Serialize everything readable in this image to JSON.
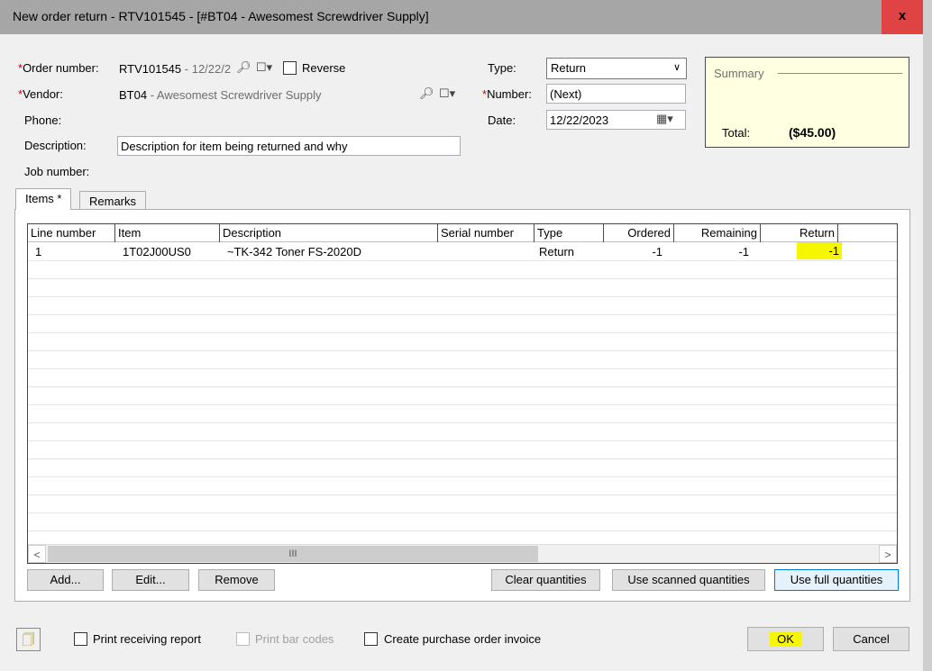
{
  "window": {
    "title": "New order return - RTV101545 - [#BT04 - Awesomest Screwdriver Supply]",
    "close_label": "x"
  },
  "form": {
    "order_number_label": "Order number:",
    "order_number_value": "RTV101545",
    "order_number_date": "- 12/22/2",
    "reverse_label": "Reverse",
    "vendor_label": "Vendor:",
    "vendor_code": "BT04",
    "vendor_name": "- Awesomest Screwdriver Supply",
    "phone_label": "Phone:",
    "description_label": "Description:",
    "description_value": "Description for item being returned and why",
    "job_number_label": "Job number:",
    "type_label": "Type:",
    "type_value": "Return",
    "number_label": "Number:",
    "number_value": "(Next)",
    "date_label": "Date:",
    "date_value": "12/22/2023",
    "required_marker": "*"
  },
  "summary": {
    "title": "Summary",
    "total_label": "Total:",
    "total_value": "($45.00)"
  },
  "tabs": [
    {
      "label": "Items *",
      "active": true
    },
    {
      "label": "Remarks",
      "active": false
    }
  ],
  "grid": {
    "columns": [
      "Line number",
      "Item",
      "Description",
      "Serial number",
      "Type",
      "Ordered",
      "Remaining",
      "Return"
    ],
    "rows": [
      {
        "line_number": "1",
        "item": "1T02J00US0",
        "description": "~TK-342 Toner FS-2020D",
        "serial_number": "",
        "type": "Return",
        "ordered": "-1",
        "remaining": "-1",
        "return": "-1"
      }
    ],
    "scroll_thumb_label": "III",
    "scroll_left": "<",
    "scroll_right": ">"
  },
  "buttons": {
    "add": "Add...",
    "edit": "Edit...",
    "remove": "Remove",
    "clear_quantities": "Clear quantities",
    "use_scanned_quantities": "Use scanned quantities",
    "use_full_quantities": "Use full quantities",
    "ok": "OK",
    "cancel": "Cancel"
  },
  "footer": {
    "print_receiving_report": "Print receiving report",
    "print_bar_codes": "Print bar codes",
    "create_purchase_order_invoice": "Create purchase order invoice"
  },
  "colors": {
    "highlight": "#f6f600",
    "required": "#d00000",
    "summary_bg": "#ffffe1",
    "close_button": "#e04343"
  }
}
